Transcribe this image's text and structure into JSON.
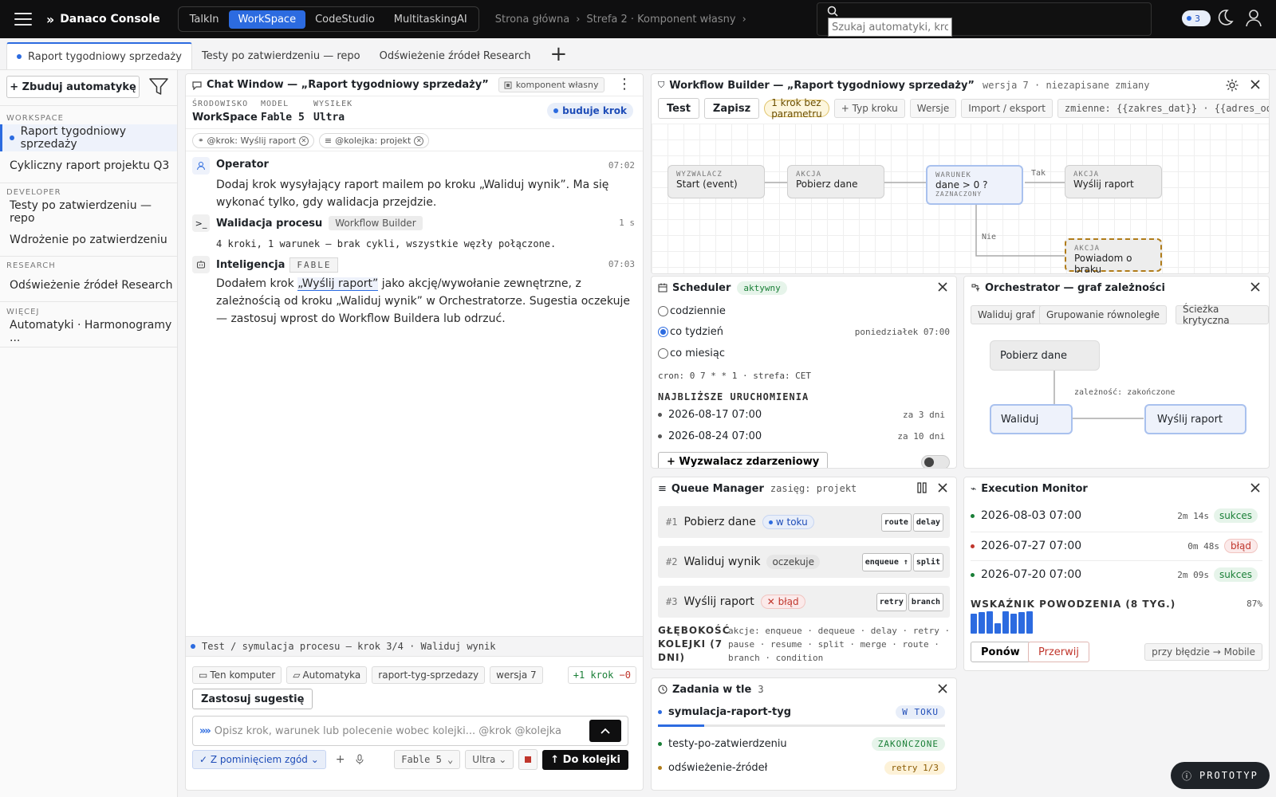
{
  "app": {
    "brand": "Danaco Console"
  },
  "top_tabs": [
    "TalkIn",
    "WorkSpace",
    "CodeStudio",
    "MultitaskingAI"
  ],
  "breadcrumb": [
    "Strona główna",
    "Strefa 2 · Komponent własny"
  ],
  "search": {
    "placeholder": "Szukaj automatyki, krok"
  },
  "notifications": {
    "count": "3"
  },
  "doc_tabs": [
    "Raport tygodniowy sprzedaży",
    "Testy po zatwierdzeniu — repo",
    "Odświeżenie źródeł Research"
  ],
  "sidebar": {
    "build_label": "+ Zbuduj automatykę",
    "groups": [
      {
        "label": "WORKSPACE",
        "items": [
          "Raport tygodniowy sprzedaży",
          "Cykliczny raport projektu Q3"
        ]
      },
      {
        "label": "DEVELOPER",
        "items": [
          "Testy po zatwierdzeniu — repo",
          "Wdrożenie po zatwierdzeniu"
        ]
      },
      {
        "label": "RESEARCH",
        "items": [
          "Odświeżenie źródeł Research"
        ]
      },
      {
        "label": "WIĘCEJ",
        "items": [
          "Automatyki · Harmonogramy ..."
        ]
      }
    ]
  },
  "chat": {
    "title": "Chat Window — „Raport tygodniowy sprzedaży”",
    "badge": "komponent własny",
    "env_labels": [
      "ŚRODOWISKO",
      "MODEL",
      "WYSIŁEK"
    ],
    "env_values": [
      "WorkSpace",
      "Fable 5",
      "Ultra"
    ],
    "status_badge": "buduje krok",
    "chips": [
      "@krok: Wyślij raport",
      "@kolejka: projekt"
    ],
    "messages": [
      {
        "who": "Operator",
        "time": "07:02",
        "text": "Dodaj krok wysyłający raport mailem po kroku „Waliduj wynik”. Ma się wykonać tylko, gdy walidacja przejdzie."
      },
      {
        "who": "Walidacja procesu",
        "tag": "Workflow Builder",
        "time": "1 s",
        "text": "4 kroki, 1 warunek — brak cykli, wszystkie węzły połączone."
      },
      {
        "who": "Inteligencja",
        "tag": "FABLE",
        "time": "07:03",
        "text_pre": "Dodałem krok ",
        "text_hl": "„Wyślij raport”",
        "text_post": " jako akcję/wywołanie zewnętrzne, z zależnością od kroku „Waliduj wynik” w Orchestratorze. Sugestia oczekuje — zastosuj wprost do Workflow Buildera lub odrzuć."
      }
    ],
    "status_line": "Test / symulacja procesu — krok 3/4 · Waliduj wynik",
    "context_chips": [
      "Ten komputer",
      "Automatyka",
      "raport-tyg-sprzedazy",
      "wersja 7"
    ],
    "diff_plus": "+1 krok",
    "diff_minus": "−0",
    "apply_label": "Zastosuj sugestię",
    "input_placeholder": "Opisz krok, warunek lub polecenie wobec kolejki...  @krok  @kolejka",
    "consent_label": "Z pominięciem zgód",
    "model_select": "Fable 5",
    "effort_select": "Ultra",
    "queue_button": "↑ Do kolejki"
  },
  "workflow": {
    "title": "Workflow Builder — „Raport tygodniowy sprzedaży”",
    "meta": "wersja 7 · niezapisane zmiany",
    "test_label": "Test",
    "save_label": "Zapisz",
    "warning": "1 krok bez parametru",
    "chips": [
      "+ Typ kroku",
      "Wersje",
      "Import / eksport",
      "zmienne: {{zakres_dat}} · {{adres_odbiorcy}}"
    ],
    "nodes": [
      {
        "kind": "WYZWALACZ",
        "label": "Start (event)"
      },
      {
        "kind": "AKCJA",
        "label": "Pobierz dane"
      },
      {
        "kind": "WARUNEK",
        "label": "dane > 0 ?",
        "note": "ZAZNACZONY"
      },
      {
        "kind": "AKCJA",
        "label": "Wyślij raport"
      },
      {
        "kind": "AKCJA",
        "label": "Powiadom o braku"
      }
    ],
    "edge_yes": "Tak",
    "edge_no": "Nie"
  },
  "scheduler": {
    "title": "Scheduler",
    "status": "aktywny",
    "options": [
      "codziennie",
      "co tydzień",
      "co miesiąc"
    ],
    "selected": 1,
    "weekly_time": "poniedziałek 07:00",
    "cron": "cron: 0 7 * * 1 · strefa: CET",
    "next_title": "NAJBLIŻSZE URUCHOMIENIA",
    "next_runs": [
      {
        "date": "2026-08-17 07:00",
        "rel": "za 3 dni"
      },
      {
        "date": "2026-08-24 07:00",
        "rel": "za 10 dni"
      }
    ],
    "event_trigger": "+ Wyzwalacz zdarzeniowy"
  },
  "orchestrator": {
    "title": "Orchestrator — graf zależności",
    "buttons": [
      "Waliduj graf",
      "Grupowanie równoległe",
      "Ścieżka krytyczna"
    ],
    "nodes": [
      "Pobierz dane",
      "Waliduj",
      "Wyślij raport"
    ],
    "edge_label": "zależność: zakończone"
  },
  "queue": {
    "title": "Queue Manager",
    "scope": "zasięg: projekt",
    "rows": [
      {
        "n": "#1",
        "label": "Pobierz dane",
        "status": "w toku",
        "actions": [
          "route",
          "delay"
        ]
      },
      {
        "n": "#2",
        "label": "Waliduj wynik",
        "status": "oczekuje",
        "actions": [
          "enqueue ↑",
          "split"
        ]
      },
      {
        "n": "#3",
        "label": "Wyślij raport",
        "status": "błąd",
        "actions": [
          "retry",
          "branch"
        ]
      }
    ],
    "depth_label": "GŁĘBOKOŚĆ KOLEJKI (7 DNI)",
    "ops": "akcje: enqueue · dequeue · delay · retry · pause · resume · split · merge · route · branch · condition"
  },
  "execution": {
    "title": "Execution Monitor",
    "runs": [
      {
        "date": "2026-08-03 07:00",
        "dur": "2m 14s",
        "status": "sukces"
      },
      {
        "date": "2026-07-27 07:00",
        "dur": "0m 48s",
        "status": "błąd"
      },
      {
        "date": "2026-07-20 07:00",
        "dur": "2m 09s",
        "status": "sukces"
      }
    ],
    "rate_label": "WSKAŹNIK POWODZENIA (8 TYG.)",
    "rate_value": "87%",
    "rate_bars": [
      0.9,
      0.95,
      1.0,
      0.45,
      1.0,
      0.9,
      0.95,
      1.0
    ],
    "resume": "Ponów",
    "abort": "Przerwij",
    "on_error": "przy błędzie → Mobile"
  },
  "tasks": {
    "title": "Zadania w tle",
    "count": "3",
    "items": [
      {
        "name": "symulacja-raport-tyg",
        "status": "W TOKU",
        "progress": 0.16
      },
      {
        "name": "testy-po-zatwierdzeniu",
        "status": "ZAKOŃCZONE"
      },
      {
        "name": "odświeżenie-źródeł",
        "status": "retry 1/3"
      }
    ]
  },
  "footer": {
    "proto": "PROTOTYP"
  },
  "colors": {
    "accent": "#2c6be0",
    "success": "#1a7f37",
    "error": "#c0362c",
    "warning": "#b07c1a"
  }
}
